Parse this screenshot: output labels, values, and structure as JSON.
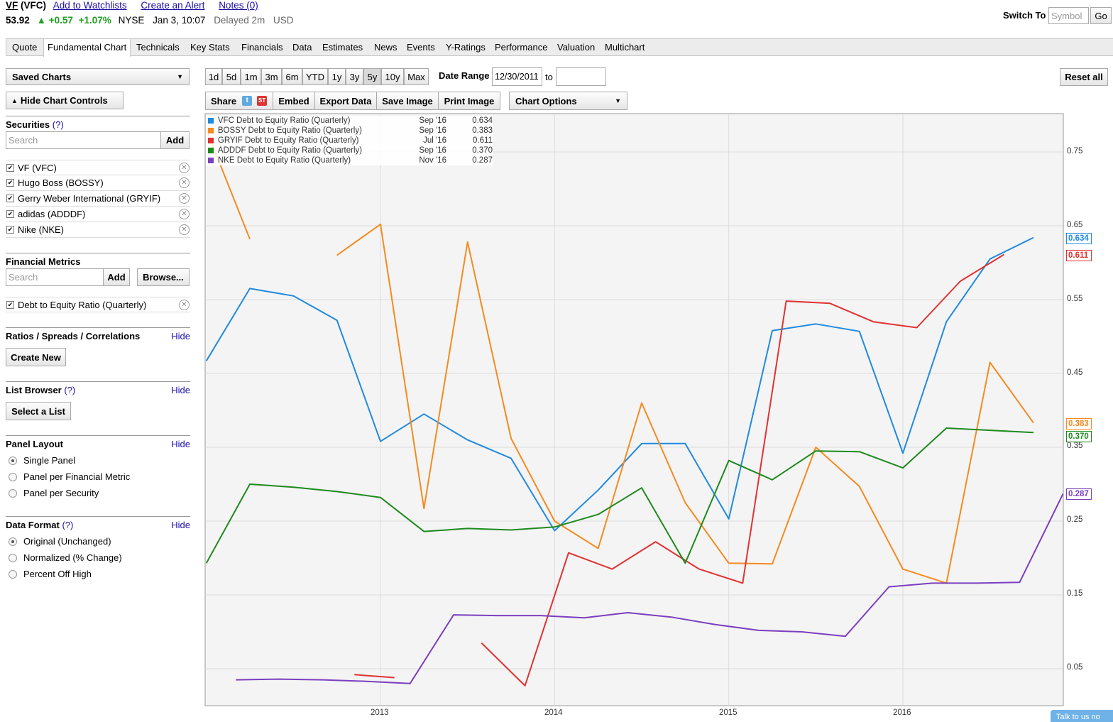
{
  "quote": {
    "ticker": "VF",
    "name_link": "(VFC)",
    "add_watch": "Add to Watchlists",
    "alert": "Create an Alert",
    "notes": "Notes (0)",
    "price": "53.92",
    "arrow": "▲",
    "chg": "+0.57",
    "pct": "+1.07%",
    "exch": "NYSE",
    "time": "Jan 3, 10:07",
    "delay": "Delayed 2m",
    "ccy": "USD"
  },
  "switch": {
    "label": "Switch To",
    "placeholder": "Symbol",
    "go": "Go"
  },
  "tabs": [
    "Quote",
    "Fundamental Chart",
    "Technicals",
    "Key Stats",
    "Financials",
    "Data",
    "Estimates",
    "News",
    "Events",
    "Y-Ratings",
    "Performance",
    "Valuation",
    "Multichart"
  ],
  "sidebar": {
    "saved": "Saved Charts",
    "hide_controls": "Hide Chart Controls",
    "securities": {
      "title": "Securities",
      "help": "(?)",
      "search_ph": "Search",
      "add": "Add",
      "items": [
        "VF (VFC)",
        "Hugo Boss (BOSSY)",
        "Gerry Weber International (GRYIF)",
        "adidas (ADDDF)",
        "Nike (NKE)"
      ]
    },
    "metrics": {
      "title": "Financial Metrics",
      "search_ph": "Search",
      "add": "Add",
      "browse": "Browse...",
      "item": "Debt to Equity Ratio (Quarterly)"
    },
    "ratios": {
      "title": "Ratios / Spreads / Correlations",
      "hide": "Hide",
      "btn": "Create New"
    },
    "list": {
      "title": "List Browser",
      "help": "(?)",
      "hide": "Hide",
      "btn": "Select a List"
    },
    "panel": {
      "title": "Panel Layout",
      "hide": "Hide",
      "opts": [
        "Single Panel",
        "Panel per Financial Metric",
        "Panel per Security"
      ],
      "selected": 0
    },
    "format": {
      "title": "Data Format",
      "help": "(?)",
      "hide": "Hide",
      "opts": [
        "Original (Unchanged)",
        "Normalized (% Change)",
        "Percent Off High"
      ],
      "selected": 0
    }
  },
  "toolbar": {
    "ranges": [
      "1d",
      "5d",
      "1m",
      "3m",
      "6m",
      "YTD",
      "1y",
      "3y",
      "5y",
      "10y",
      "Max"
    ],
    "active_range": "5y",
    "date_range_label": "Date Range",
    "from": "12/30/2011",
    "to_label": "to",
    "to": "",
    "reset": "Reset all",
    "share": "Share",
    "embed": "Embed",
    "export": "Export Data",
    "save": "Save Image",
    "print": "Print Image",
    "options": "Chart Options"
  },
  "chat": "Talk to us no",
  "chart_data": {
    "type": "line",
    "x_ticks": [
      "2013",
      "2014",
      "2015",
      "2016"
    ],
    "y_ticks": [
      "0.75",
      "0.65",
      "0.55",
      "0.45",
      "0.35",
      "0.25",
      "0.15",
      "0.05"
    ],
    "ylim": [
      0.0,
      0.8
    ],
    "xlim": [
      2012.0,
      2016.92
    ],
    "grid": true,
    "legend_position": "top-left",
    "series": [
      {
        "name": "VFC Debt to Equity Ratio (Quarterly)",
        "color": "#1f8ae0",
        "last_date": "Sep '16",
        "last": "0.634",
        "points": [
          [
            2012.0,
            0.467
          ],
          [
            2012.25,
            0.565
          ],
          [
            2012.5,
            0.555
          ],
          [
            2012.75,
            0.522
          ],
          [
            2013.0,
            0.358
          ],
          [
            2013.25,
            0.395
          ],
          [
            2013.5,
            0.36
          ],
          [
            2013.75,
            0.335
          ],
          [
            2014.0,
            0.237
          ],
          [
            2014.25,
            0.292
          ],
          [
            2014.5,
            0.355
          ],
          [
            2014.75,
            0.355
          ],
          [
            2015.0,
            0.253
          ],
          [
            2015.25,
            0.508
          ],
          [
            2015.5,
            0.517
          ],
          [
            2015.75,
            0.507
          ],
          [
            2016.0,
            0.342
          ],
          [
            2016.25,
            0.52
          ],
          [
            2016.5,
            0.605
          ],
          [
            2016.75,
            0.634
          ]
        ]
      },
      {
        "name": "BOSSY Debt to Equity Ratio (Quarterly)",
        "color": "#f58a1f",
        "last_date": "Sep '16",
        "last": "0.383",
        "points": [
          [
            [
              2012.0,
              0.78
            ],
            [
              2012.25,
              0.632
            ]
          ],
          [
            [
              2012.75,
              0.61
            ],
            [
              2013.0,
              0.652
            ],
            [
              2013.25,
              0.267
            ],
            [
              2013.5,
              0.628
            ],
            [
              2013.75,
              0.362
            ],
            [
              2014.0,
              0.25
            ],
            [
              2014.25,
              0.213
            ],
            [
              2014.5,
              0.41
            ],
            [
              2014.75,
              0.275
            ],
            [
              2015.0,
              0.193
            ],
            [
              2015.25,
              0.192
            ],
            [
              2015.5,
              0.35
            ],
            [
              2015.75,
              0.297
            ],
            [
              2016.0,
              0.185
            ],
            [
              2016.25,
              0.166
            ],
            [
              2016.5,
              0.465
            ],
            [
              2016.75,
              0.383
            ]
          ]
        ]
      },
      {
        "name": "GRYIF Debt to Equity Ratio (Quarterly)",
        "color": "#e03232",
        "last_date": "Jul '16",
        "last": "0.611",
        "points": [
          [
            [
              2012.85,
              0.042
            ],
            [
              2013.08,
              0.038
            ]
          ],
          [
            [
              2013.58,
              0.085
            ],
            [
              2013.83,
              0.027
            ],
            [
              2014.08,
              0.207
            ],
            [
              2014.33,
              0.185
            ],
            [
              2014.58,
              0.222
            ],
            [
              2014.83,
              0.185
            ],
            [
              2015.08,
              0.166
            ],
            [
              2015.33,
              0.548
            ],
            [
              2015.58,
              0.545
            ],
            [
              2015.83,
              0.52
            ],
            [
              2016.08,
              0.512
            ],
            [
              2016.33,
              0.575
            ],
            [
              2016.58,
              0.611
            ]
          ]
        ]
      },
      {
        "name": "ADDDF Debt to Equity Ratio (Quarterly)",
        "color": "#1e8a1e",
        "last_date": "Sep '16",
        "last": "0.370",
        "points": [
          [
            2012.0,
            0.193
          ],
          [
            2012.25,
            0.3
          ],
          [
            2012.5,
            0.296
          ],
          [
            2012.75,
            0.29
          ],
          [
            2013.0,
            0.282
          ],
          [
            2013.25,
            0.236
          ],
          [
            2013.5,
            0.24
          ],
          [
            2013.75,
            0.238
          ],
          [
            2014.0,
            0.242
          ],
          [
            2014.25,
            0.259
          ],
          [
            2014.5,
            0.295
          ],
          [
            2014.75,
            0.193
          ],
          [
            2015.0,
            0.332
          ],
          [
            2015.25,
            0.306
          ],
          [
            2015.5,
            0.345
          ],
          [
            2015.75,
            0.344
          ],
          [
            2016.0,
            0.322
          ],
          [
            2016.25,
            0.376
          ],
          [
            2016.5,
            0.373
          ],
          [
            2016.75,
            0.37
          ]
        ]
      },
      {
        "name": "NKE Debt to Equity Ratio (Quarterly)",
        "color": "#7b3fbf",
        "last_date": "Nov '16",
        "last": "0.287",
        "points": [
          [
            2012.17,
            0.035
          ],
          [
            2012.42,
            0.036
          ],
          [
            2012.67,
            0.035
          ],
          [
            2012.92,
            0.033
          ],
          [
            2013.17,
            0.03
          ],
          [
            2013.42,
            0.123
          ],
          [
            2013.67,
            0.122
          ],
          [
            2013.92,
            0.122
          ],
          [
            2014.17,
            0.119
          ],
          [
            2014.42,
            0.126
          ],
          [
            2014.67,
            0.12
          ],
          [
            2014.92,
            0.11
          ],
          [
            2015.17,
            0.102
          ],
          [
            2015.42,
            0.1
          ],
          [
            2015.67,
            0.094
          ],
          [
            2015.92,
            0.161
          ],
          [
            2016.17,
            0.166
          ],
          [
            2016.42,
            0.166
          ],
          [
            2016.67,
            0.167
          ],
          [
            2016.92,
            0.287
          ]
        ]
      }
    ]
  }
}
